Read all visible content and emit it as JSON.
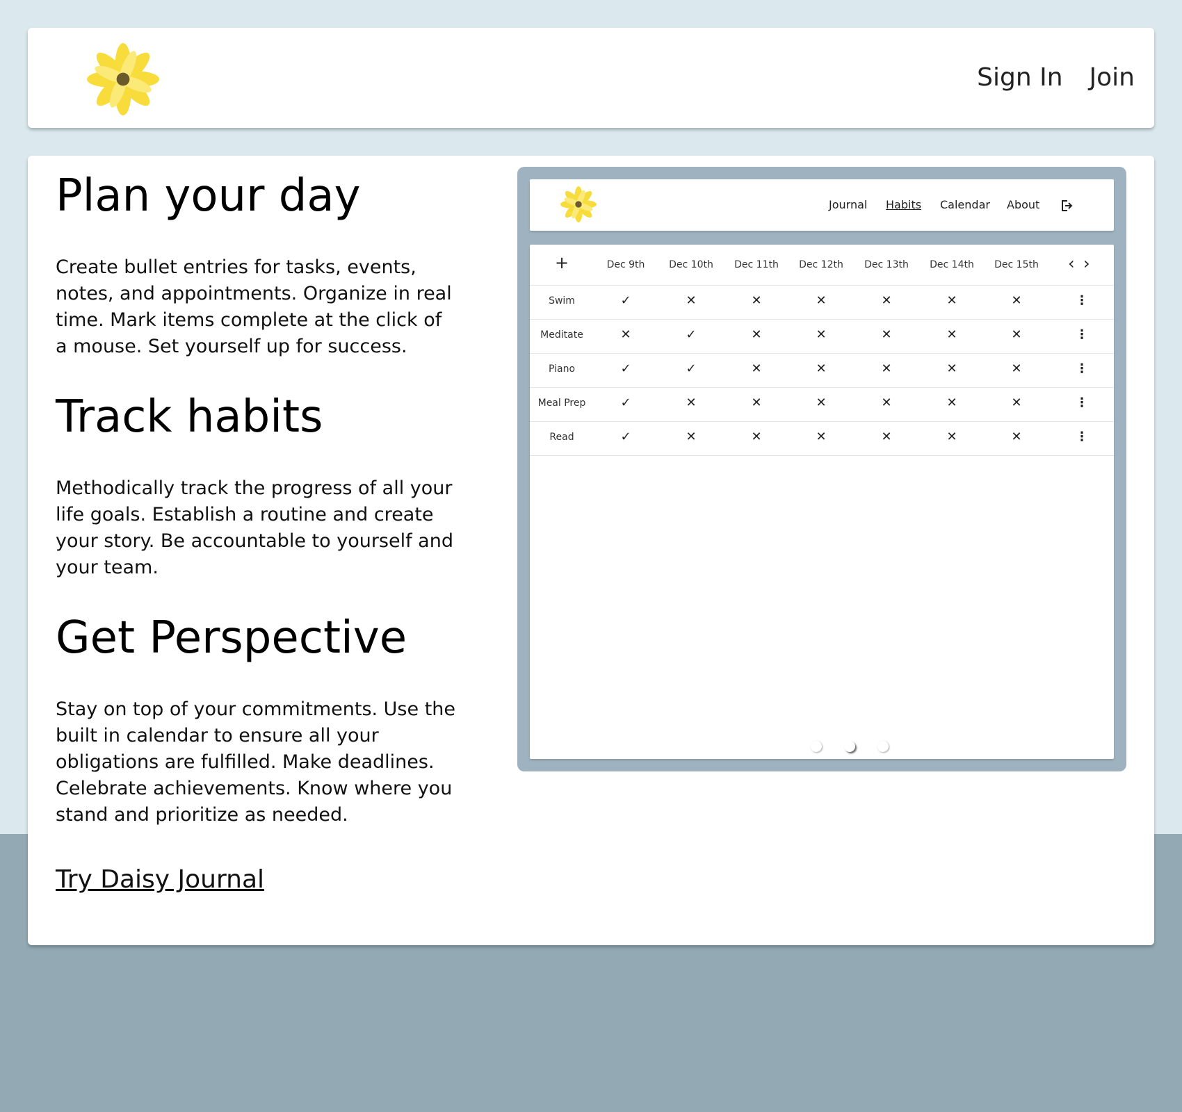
{
  "header": {
    "logo_icon": "daisy-logo-icon",
    "sign_in": "Sign In",
    "join": "Join"
  },
  "sections": [
    {
      "title": "Plan your day",
      "body": "Create bullet entries for tasks, events, notes, and appointments. Organize in real time. Mark items complete at the click of a mouse. Set yourself up for success."
    },
    {
      "title": "Track habits",
      "body": "Methodically track the progress of all your life goals. Establish a routine and create your story. Be accountable to yourself and your team."
    },
    {
      "title": "Get Perspective",
      "body": "Stay on top of your commitments. Use the built in calendar to ensure all your obligations are fulfilled. Make deadlines. Celebrate achievements. Know where you stand and prioritize as needed."
    }
  ],
  "cta": "Try Daisy Journal",
  "preview": {
    "nav": {
      "journal": "Journal",
      "habits": "Habits",
      "calendar": "Calendar",
      "about": "About",
      "logout_icon": "logout-icon",
      "active": "Habits"
    },
    "add_icon": "+",
    "prev_icon": "‹",
    "next_icon": "›",
    "dates": [
      "Dec 9th",
      "Dec 10th",
      "Dec 11th",
      "Dec 12th",
      "Dec 13th",
      "Dec 14th",
      "Dec 15th"
    ],
    "habits": [
      {
        "name": "Swim",
        "done": [
          true,
          false,
          false,
          false,
          false,
          false,
          false
        ]
      },
      {
        "name": "Meditate",
        "done": [
          false,
          true,
          false,
          false,
          false,
          false,
          false
        ]
      },
      {
        "name": "Piano",
        "done": [
          true,
          true,
          false,
          false,
          false,
          false,
          false
        ]
      },
      {
        "name": "Meal Prep",
        "done": [
          true,
          false,
          false,
          false,
          false,
          false,
          false
        ]
      },
      {
        "name": "Read",
        "done": [
          true,
          false,
          false,
          false,
          false,
          false,
          false
        ]
      }
    ],
    "pager": {
      "count": 3,
      "active": 1
    }
  }
}
